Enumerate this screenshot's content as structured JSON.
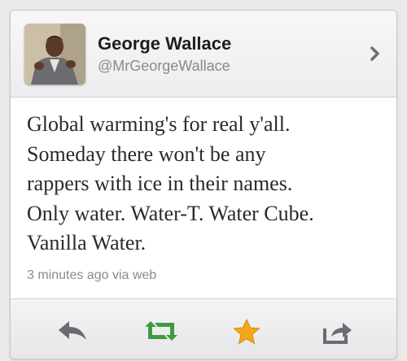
{
  "tweet": {
    "author_name": "George Wallace",
    "author_handle": "@MrGeorgeWallace",
    "text": "Global warming's for real y'all.\nSomeday there won't be any\nrappers with ice in their names.\nOnly water. Water-T. Water Cube.\nVanilla Water.",
    "meta": "3 minutes ago via web"
  },
  "icons": {
    "chevron": "chevron-right-icon",
    "reply": "reply-icon",
    "retweet": "retweet-icon",
    "favorite": "star-icon",
    "share": "share-icon"
  },
  "colors": {
    "retweet": "#3e9b3f",
    "favorite": "#f4a61c",
    "icon_gray": "#6c6c70"
  }
}
